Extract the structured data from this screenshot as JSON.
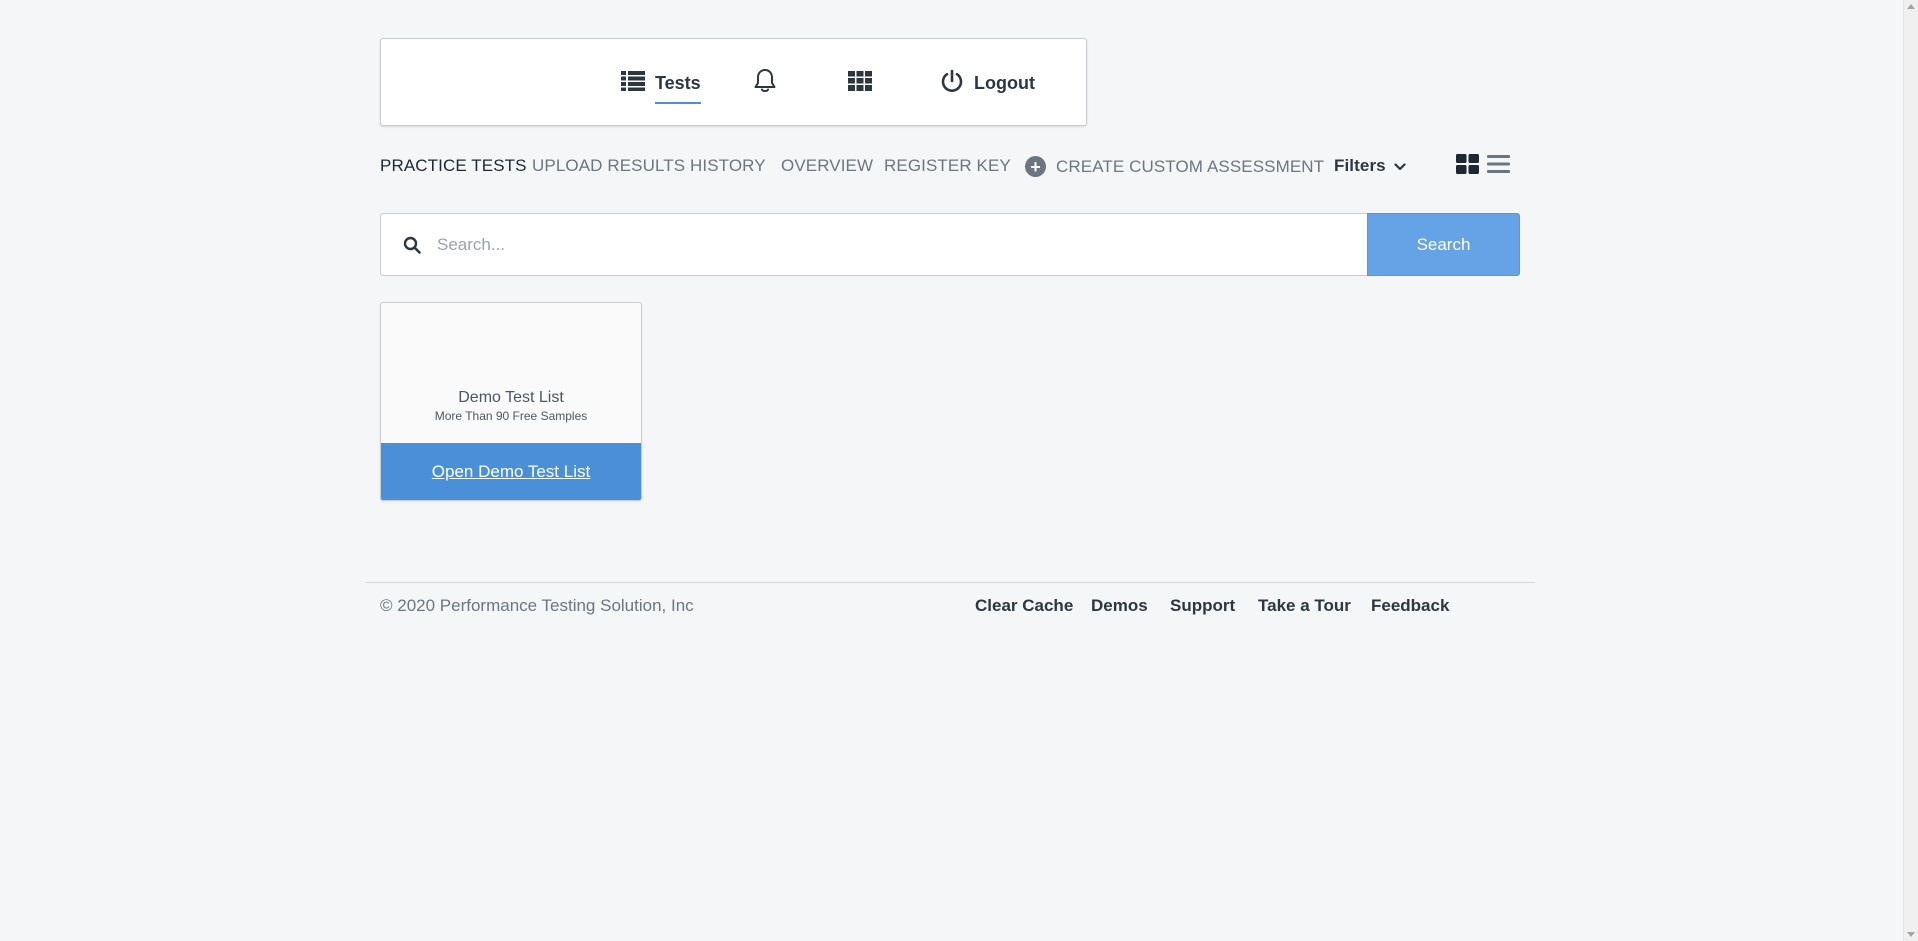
{
  "navbar": {
    "tests_label": "Tests",
    "logout_label": "Logout",
    "icons": [
      "list-icon",
      "bell-icon",
      "grid-apps-icon",
      "power-icon"
    ]
  },
  "subnav": {
    "items": [
      "PRACTICE TESTS",
      "UPLOAD RESULTS",
      "HISTORY",
      "OVERVIEW",
      "REGISTER KEY"
    ],
    "create_label": "CREATE CUSTOM ASSESSMENT",
    "filters_label": "Filters",
    "active": "PRACTICE TESTS"
  },
  "search": {
    "placeholder": "Search...",
    "value": "",
    "button_label": "Search"
  },
  "cards": [
    {
      "title": "Demo Test List",
      "subtitle": "More Than 90 Free Samples",
      "button_label": "Open Demo Test List"
    }
  ],
  "footer": {
    "copyright": "© 2020 Performance Testing Solution, Inc",
    "links": [
      "Clear Cache",
      "Demos",
      "Support",
      "Take a Tour",
      "Feedback"
    ]
  },
  "colors": {
    "background": "#f5f6f8",
    "accent": "#4a90d9",
    "search_button": "#66a3e6",
    "text_dark": "#2d3741",
    "text_muted": "#6b7680"
  }
}
